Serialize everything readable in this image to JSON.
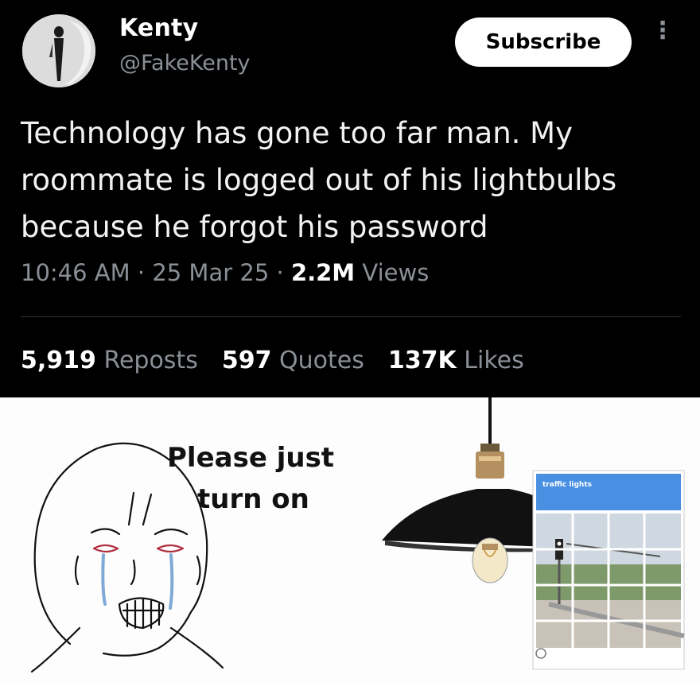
{
  "tweet": {
    "author": {
      "name": "Kenty",
      "handle": "@FakeKenty"
    },
    "subscribe_label": "Subscribe",
    "text": "Technology has gone too far man. My roommate is logged out of his lightbulbs because he forgot his password",
    "meta": {
      "time": "10:46 AM",
      "date": "25 Mar 25",
      "views_count": "2.2M",
      "views_label": "Views"
    },
    "stats": {
      "reposts_count": "5,919",
      "reposts_label": "Reposts",
      "quotes_count": "597",
      "quotes_label": "Quotes",
      "likes_count": "137K",
      "likes_label": "Likes"
    }
  },
  "meme": {
    "caption_line1": "Please just",
    "caption_line2": "turn on",
    "captcha_title": "traffic lights"
  },
  "colors": {
    "background": "#000000",
    "text": "#ffffff",
    "muted": "#8b9096",
    "captcha_blue": "#4a90e2"
  }
}
